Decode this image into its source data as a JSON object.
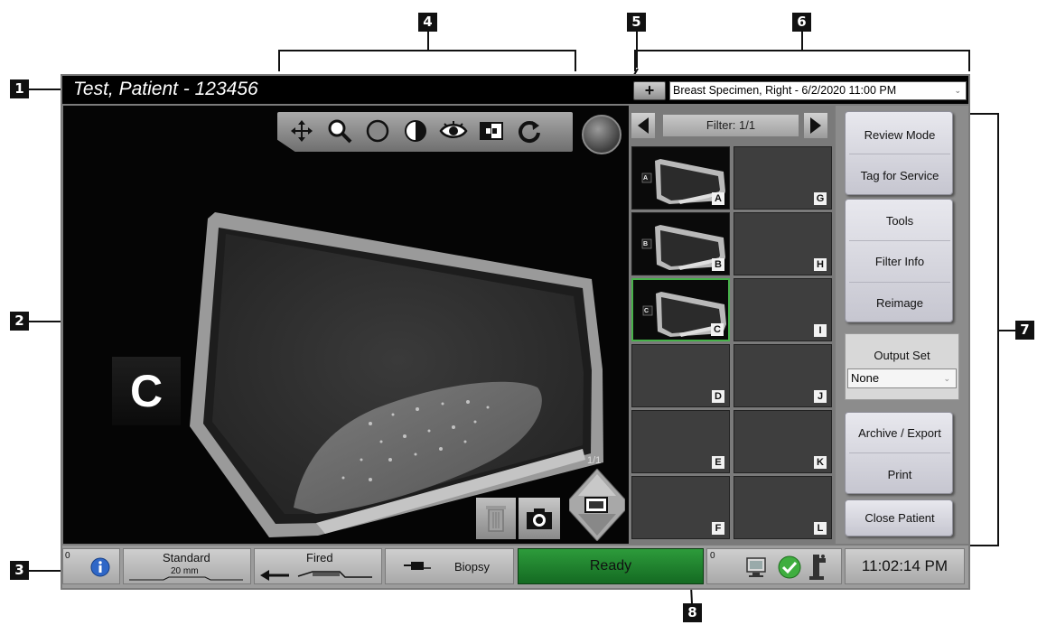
{
  "callouts": [
    "1",
    "2",
    "3",
    "4",
    "5",
    "6",
    "7",
    "8"
  ],
  "header": {
    "patient": "Test, Patient - 123456",
    "add_label": "+",
    "study": "Breast Specimen, Right - 6/2/2020 11:00 PM",
    "study_chevron": "⌄"
  },
  "viewer": {
    "tools": [
      "move-icon",
      "magnify-icon",
      "circle-icon",
      "contrast-icon",
      "eye-icon",
      "invert-icon",
      "rotate-icon"
    ],
    "marker": "C",
    "page": "1/1"
  },
  "thumbnails": {
    "filter": "Filter: 1/1",
    "items": [
      {
        "letter": "A",
        "tag": "A",
        "has_image": true,
        "selected": false
      },
      {
        "letter": "G",
        "has_image": false,
        "selected": false
      },
      {
        "letter": "B",
        "tag": "B",
        "has_image": true,
        "selected": false
      },
      {
        "letter": "H",
        "has_image": false,
        "selected": false
      },
      {
        "letter": "C",
        "tag": "C",
        "has_image": true,
        "selected": true
      },
      {
        "letter": "I",
        "has_image": false,
        "selected": false
      },
      {
        "letter": "D",
        "has_image": false,
        "selected": false
      },
      {
        "letter": "J",
        "has_image": false,
        "selected": false
      },
      {
        "letter": "E",
        "has_image": false,
        "selected": false
      },
      {
        "letter": "K",
        "has_image": false,
        "selected": false
      },
      {
        "letter": "F",
        "has_image": false,
        "selected": false
      },
      {
        "letter": "L",
        "has_image": false,
        "selected": false
      }
    ]
  },
  "side": {
    "review_mode": "Review Mode",
    "tag_for_service": "Tag for Service",
    "tools": "Tools",
    "filter_info": "Filter Info",
    "reimage": "Reimage",
    "output_set_label": "Output Set",
    "output_set_value": "None",
    "archive_export": "Archive / Export",
    "print": "Print",
    "close_patient": "Close Patient"
  },
  "status": {
    "left_count": "0",
    "standard": "Standard",
    "standard_sub": "20 mm",
    "fired": "Fired",
    "biopsy": "Biopsy",
    "ready": "Ready",
    "right_count": "0",
    "time": "11:02:14 PM",
    "ready_color": "#1f8a2d"
  }
}
